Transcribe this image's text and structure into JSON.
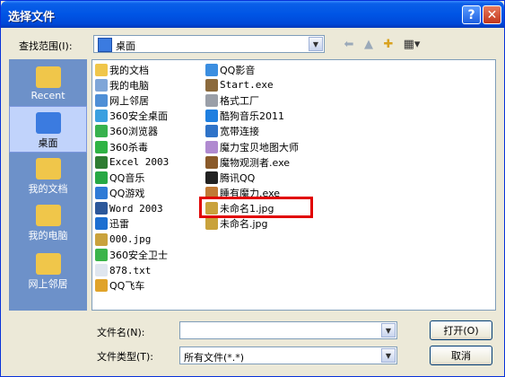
{
  "title": "选择文件",
  "title_buttons": {
    "help": "?",
    "close": "✕"
  },
  "lookin": {
    "label": "查找范围(I):",
    "value": "桌面"
  },
  "places": [
    {
      "label": "Recent",
      "icon": "folder-icon"
    },
    {
      "label": "桌面",
      "icon": "desktop-icon",
      "selected": true
    },
    {
      "label": "我的文档",
      "icon": "my-documents-icon"
    },
    {
      "label": "我的电脑",
      "icon": "my-computer-icon"
    },
    {
      "label": "网上邻居",
      "icon": "network-icon"
    }
  ],
  "files_col1": [
    {
      "name": "我的文档",
      "icon": "my-documents-icon",
      "color": "#f0c64a"
    },
    {
      "name": "我的电脑",
      "icon": "my-computer-icon",
      "color": "#7fa6d8"
    },
    {
      "name": "网上邻居",
      "icon": "network-icon",
      "color": "#4f8fd6"
    },
    {
      "name": "360安全桌面",
      "icon": "app-icon",
      "color": "#3aa0e0"
    },
    {
      "name": "360浏览器",
      "icon": "browser-icon",
      "color": "#37b24d"
    },
    {
      "name": "360杀毒",
      "icon": "antivirus-icon",
      "color": "#2fb344"
    },
    {
      "name": "Excel 2003",
      "icon": "excel-icon",
      "color": "#2e7d32"
    },
    {
      "name": "QQ音乐",
      "icon": "music-icon",
      "color": "#27a844"
    },
    {
      "name": "QQ游戏",
      "icon": "game-icon",
      "color": "#2f7bd6"
    },
    {
      "name": "Word 2003",
      "icon": "word-icon",
      "color": "#2b579a"
    },
    {
      "name": "迅雷",
      "icon": "thunder-icon",
      "color": "#1c6fd1"
    },
    {
      "name": "000.jpg",
      "icon": "image-file-icon",
      "color": "#c9a23c"
    },
    {
      "name": "360安全卫士",
      "icon": "shield-icon",
      "color": "#3bb44a"
    },
    {
      "name": "878.txt",
      "icon": "text-file-icon",
      "color": "#dfe6ef"
    },
    {
      "name": "QQ飞车",
      "icon": "game-icon",
      "color": "#e0a32a"
    }
  ],
  "files_col2": [
    {
      "name": "QQ影音",
      "icon": "video-icon",
      "color": "#3b8ee0"
    },
    {
      "name": "Start.exe",
      "icon": "exe-icon",
      "color": "#8b6a3d"
    },
    {
      "name": "格式工厂",
      "icon": "app-icon",
      "color": "#9a9fa8"
    },
    {
      "name": "酷狗音乐2011",
      "icon": "music-icon",
      "color": "#1f7fe0"
    },
    {
      "name": "宽带连接",
      "icon": "network-icon",
      "color": "#2f73c8"
    },
    {
      "name": "魔力宝贝地图大师",
      "icon": "app-icon",
      "color": "#b08ad0"
    },
    {
      "name": "魔物观测者.exe",
      "icon": "exe-icon",
      "color": "#8a5a2a"
    },
    {
      "name": "腾讯QQ",
      "icon": "qq-icon",
      "color": "#222222"
    },
    {
      "name": "睡有魔力.exe",
      "icon": "exe-icon",
      "color": "#c07a35"
    },
    {
      "name": "未命名1.jpg",
      "icon": "image-file-icon",
      "color": "#c9a23c"
    },
    {
      "name": "未命名.jpg",
      "icon": "image-file-icon",
      "color": "#c9a23c"
    }
  ],
  "filename": {
    "label": "文件名(N):",
    "value": ""
  },
  "filetype": {
    "label": "文件类型(T):",
    "value": "所有文件(*.*)"
  },
  "buttons": {
    "open": "打开(O)",
    "cancel": "取消"
  },
  "highlight_color": "#e10000"
}
